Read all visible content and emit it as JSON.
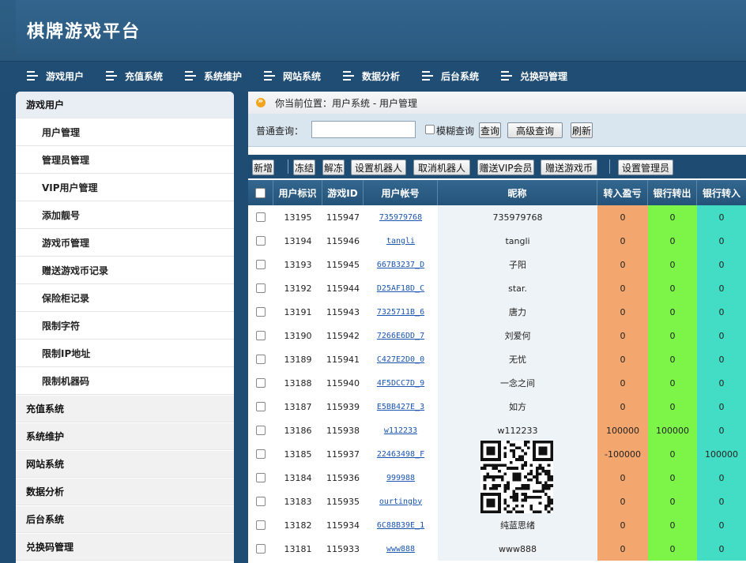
{
  "app": {
    "title": "棋牌游戏平台"
  },
  "topnav": [
    "游戏用户",
    "充值系统",
    "系统维护",
    "网站系统",
    "数据分析",
    "后台系统",
    "兑换码管理"
  ],
  "sidebar": {
    "active_section": "游戏用户",
    "sub_items": [
      "用户管理",
      "管理员管理",
      "VIP用户管理",
      "添加靓号",
      "游戏币管理",
      "赠送游戏币记录",
      "保险柜记录",
      "限制字符",
      "限制IP地址",
      "限制机器码"
    ],
    "sections": [
      "充值系统",
      "系统维护",
      "网站系统",
      "数据分析",
      "后台系统",
      "兑换码管理"
    ]
  },
  "breadcrumb": "你当前位置：用户系统 - 用户管理",
  "search": {
    "label": "普通查询：",
    "value": "",
    "fuzzy_label": "模糊查询",
    "query_btn": "查询",
    "advanced_btn": "高级查询",
    "refresh_btn": "刷新"
  },
  "toolbar": {
    "add": "新增",
    "freeze": "冻结",
    "unfreeze": "解冻",
    "set_robot": "设置机器人",
    "cancel_robot": "取消机器人",
    "gift_vip": "赠送VIP会员",
    "gift_coins": "赠送游戏币",
    "set_admin": "设置管理员"
  },
  "table": {
    "headers": [
      "用户标识",
      "游戏ID",
      "用户帐号",
      "昵称",
      "转入盈亏",
      "银行转出",
      "银行转入"
    ],
    "rows": [
      [
        "13195",
        "115947",
        "735979768",
        "735979768",
        "0",
        "0",
        "0"
      ],
      [
        "13194",
        "115946",
        "tangli",
        "tangli",
        "0",
        "0",
        "0"
      ],
      [
        "13193",
        "115945",
        "667B3237_D",
        "子阳",
        "0",
        "0",
        "0"
      ],
      [
        "13192",
        "115944",
        "D25AF18D_C",
        "star.",
        "0",
        "0",
        "0"
      ],
      [
        "13191",
        "115943",
        "7325711B_6",
        "唐力",
        "0",
        "0",
        "0"
      ],
      [
        "13190",
        "115942",
        "7266E6DD_7",
        "刘爱何",
        "0",
        "0",
        "0"
      ],
      [
        "13189",
        "115941",
        "C427E2D0_0",
        "无忧",
        "0",
        "0",
        "0"
      ],
      [
        "13188",
        "115940",
        "4F5DCC7D_9",
        "一念之间",
        "0",
        "0",
        "0"
      ],
      [
        "13187",
        "115939",
        "E5BB427E_3",
        "如方",
        "0",
        "0",
        "0"
      ],
      [
        "13186",
        "115938",
        "w112233",
        "w112233",
        "100000",
        "100000",
        "0"
      ],
      [
        "13185",
        "115937",
        "22463498_F",
        "",
        "-100000",
        "0",
        "100000"
      ],
      [
        "13184",
        "115936",
        "999988",
        "",
        "0",
        "0",
        "0"
      ],
      [
        "13183",
        "115935",
        "ourtingby",
        "",
        "0",
        "0",
        "0"
      ],
      [
        "13182",
        "115934",
        "6C88B39E_1",
        "纯蓝思绪",
        "0",
        "0",
        "0"
      ],
      [
        "13181",
        "115933",
        "www888",
        "www888",
        "0",
        "0",
        "0"
      ]
    ]
  }
}
